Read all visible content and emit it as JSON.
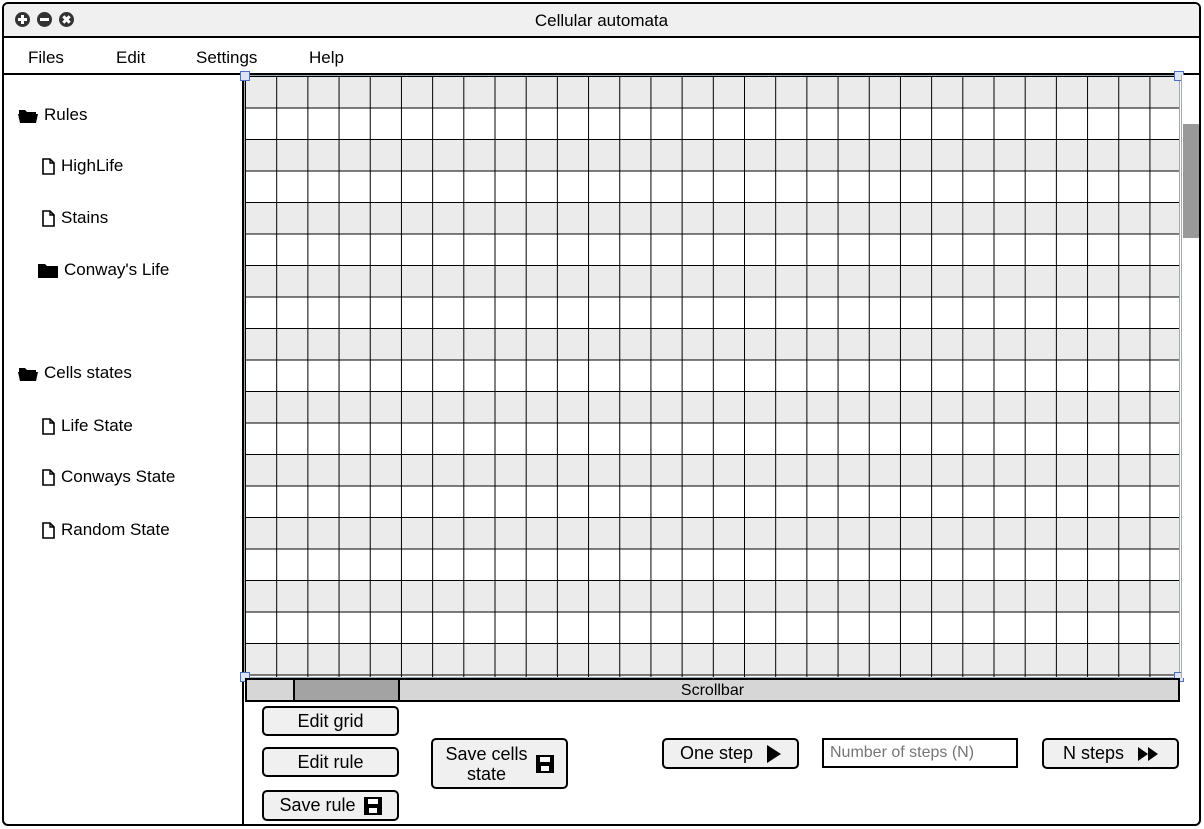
{
  "window": {
    "title": "Cellular automata"
  },
  "menu": {
    "items": [
      "Files",
      "Edit",
      "Settings",
      "Help"
    ]
  },
  "sidebar": {
    "rules_folder": "Rules",
    "rules": [
      "HighLife",
      "Stains",
      "Conway's Life"
    ],
    "states_folder": "Cells states",
    "states": [
      "Life State",
      "Conways State",
      "Random State"
    ]
  },
  "canvas": {
    "scrollbar_label": "Scrollbar"
  },
  "buttons": {
    "edit_grid": "Edit grid",
    "edit_rule": "Edit rule",
    "save_rule": "Save rule",
    "save_cells_state_line1": "Save cells",
    "save_cells_state_line2": "state",
    "one_step": "One step",
    "n_steps": "N steps"
  },
  "steps_input": {
    "placeholder": "Number of steps (N)"
  }
}
